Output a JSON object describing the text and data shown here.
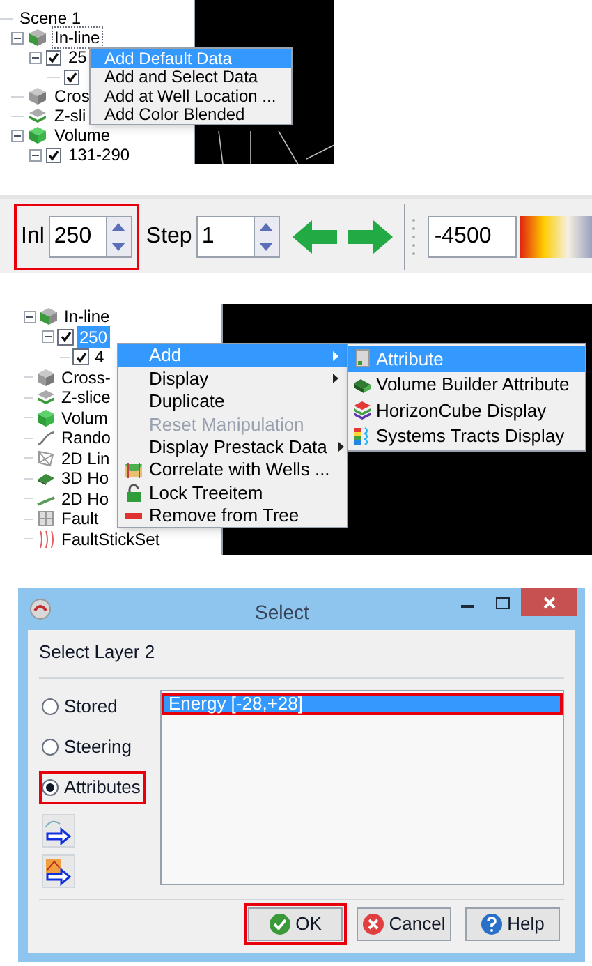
{
  "scene_tree_menu": {
    "tree": [
      {
        "label": "Scene 1",
        "focused": false,
        "children": [
          {
            "label": "In-line",
            "kind": "inline",
            "expanded": true,
            "focused": true,
            "children": [
              {
                "label": "25",
                "checked": true,
                "expanded": true,
                "focused": false,
                "children": [
                  {
                    "checked": true
                  }
                ]
              }
            ]
          },
          {
            "label": "Cros",
            "kind": "crossline",
            "focused": false
          },
          {
            "label": "Z-sli",
            "kind": "zslice",
            "focused": false
          },
          {
            "label": "Volume",
            "kind": "volume",
            "expanded": true,
            "focused": false,
            "children": [
              {
                "label": "131-290",
                "checked": true,
                "expanded": true,
                "focused": false
              }
            ]
          }
        ]
      }
    ],
    "context_menu": [
      {
        "label": "Add Default Data",
        "selected": true
      },
      {
        "label": "Add and Select Data",
        "selected": false
      },
      {
        "label": "Add at Well Location ...",
        "selected": false
      },
      {
        "label": "Add Color Blended",
        "selected": false
      }
    ]
  },
  "slice_toolbar": {
    "inline": {
      "label": "Inl",
      "value": "250",
      "highlighted": true
    },
    "step": {
      "label": "Step",
      "value": "1",
      "highlighted": false
    },
    "range_value": "-4500"
  },
  "attribute_menu": {
    "tree": [
      {
        "label": "In-line",
        "kind": "inline",
        "expanded": true,
        "selected": false,
        "children": [
          {
            "label": "250",
            "checked": true,
            "expanded": true,
            "selected": true,
            "children": [
              {
                "label": "4",
                "checked": true,
                "selected": false
              }
            ]
          }
        ]
      },
      {
        "label": "Cross-",
        "kind": "crossline",
        "selected": false
      },
      {
        "label": "Z-slice",
        "kind": "zslice",
        "selected": false
      },
      {
        "label": "Volum",
        "kind": "volume",
        "selected": false
      },
      {
        "label": "Rando",
        "kind": "random",
        "selected": false
      },
      {
        "label": "2D Lin",
        "kind": "line2d",
        "selected": false
      },
      {
        "label": "3D Ho",
        "kind": "horizon3d",
        "selected": false
      },
      {
        "label": "2D Ho",
        "kind": "horizon2d",
        "selected": false
      },
      {
        "label": "Fault",
        "kind": "fault",
        "selected": false
      },
      {
        "label": "FaultStickSet",
        "kind": "faultstick",
        "selected": false
      }
    ],
    "context_menu": [
      {
        "label": "Add",
        "kind": "text",
        "has_submenu": true,
        "selected": true,
        "disabled": false
      },
      {
        "label": "Display",
        "kind": "text",
        "has_submenu": true,
        "selected": false,
        "disabled": false
      },
      {
        "label": "Duplicate",
        "kind": "text",
        "has_submenu": false,
        "selected": false,
        "disabled": false
      },
      {
        "label": "Reset Manipulation",
        "kind": "text",
        "has_submenu": false,
        "selected": false,
        "disabled": true
      },
      {
        "label": "Display Prestack Data",
        "kind": "text",
        "has_submenu": true,
        "selected": false,
        "disabled": false
      },
      {
        "label": "Correlate with Wells ...",
        "kind": "correlate",
        "has_submenu": false,
        "selected": false,
        "disabled": false
      },
      {
        "label": "Lock Treeitem",
        "kind": "lock",
        "has_submenu": false,
        "selected": false,
        "disabled": false
      },
      {
        "label": "Remove from Tree",
        "kind": "remove",
        "has_submenu": false,
        "selected": false,
        "disabled": false
      }
    ],
    "submenu": [
      {
        "label": "Attribute",
        "kind": "attribute",
        "selected": true
      },
      {
        "label": "Volume Builder Attribute",
        "kind": "volume_builder",
        "selected": false
      },
      {
        "label": "HorizonCube Display",
        "kind": "horizoncube",
        "selected": false
      },
      {
        "label": "Systems Tracts Display",
        "kind": "systems_tracts",
        "selected": false
      }
    ]
  },
  "select_dialog": {
    "title": "Select",
    "heading": "Select Layer 2",
    "sources": [
      {
        "label": "Stored",
        "selected": false,
        "highlighted": false
      },
      {
        "label": "Steering",
        "selected": false,
        "highlighted": false
      },
      {
        "label": "Attributes",
        "selected": true,
        "highlighted": true
      }
    ],
    "items": [
      {
        "label": "Energy [-28,+28]",
        "selected": true,
        "highlighted": true
      }
    ],
    "buttons": [
      {
        "label": "OK",
        "kind": "ok",
        "highlighted": true
      },
      {
        "label": "Cancel",
        "kind": "cancel",
        "highlighted": false
      },
      {
        "label": "Help",
        "kind": "help",
        "highlighted": false
      }
    ]
  }
}
